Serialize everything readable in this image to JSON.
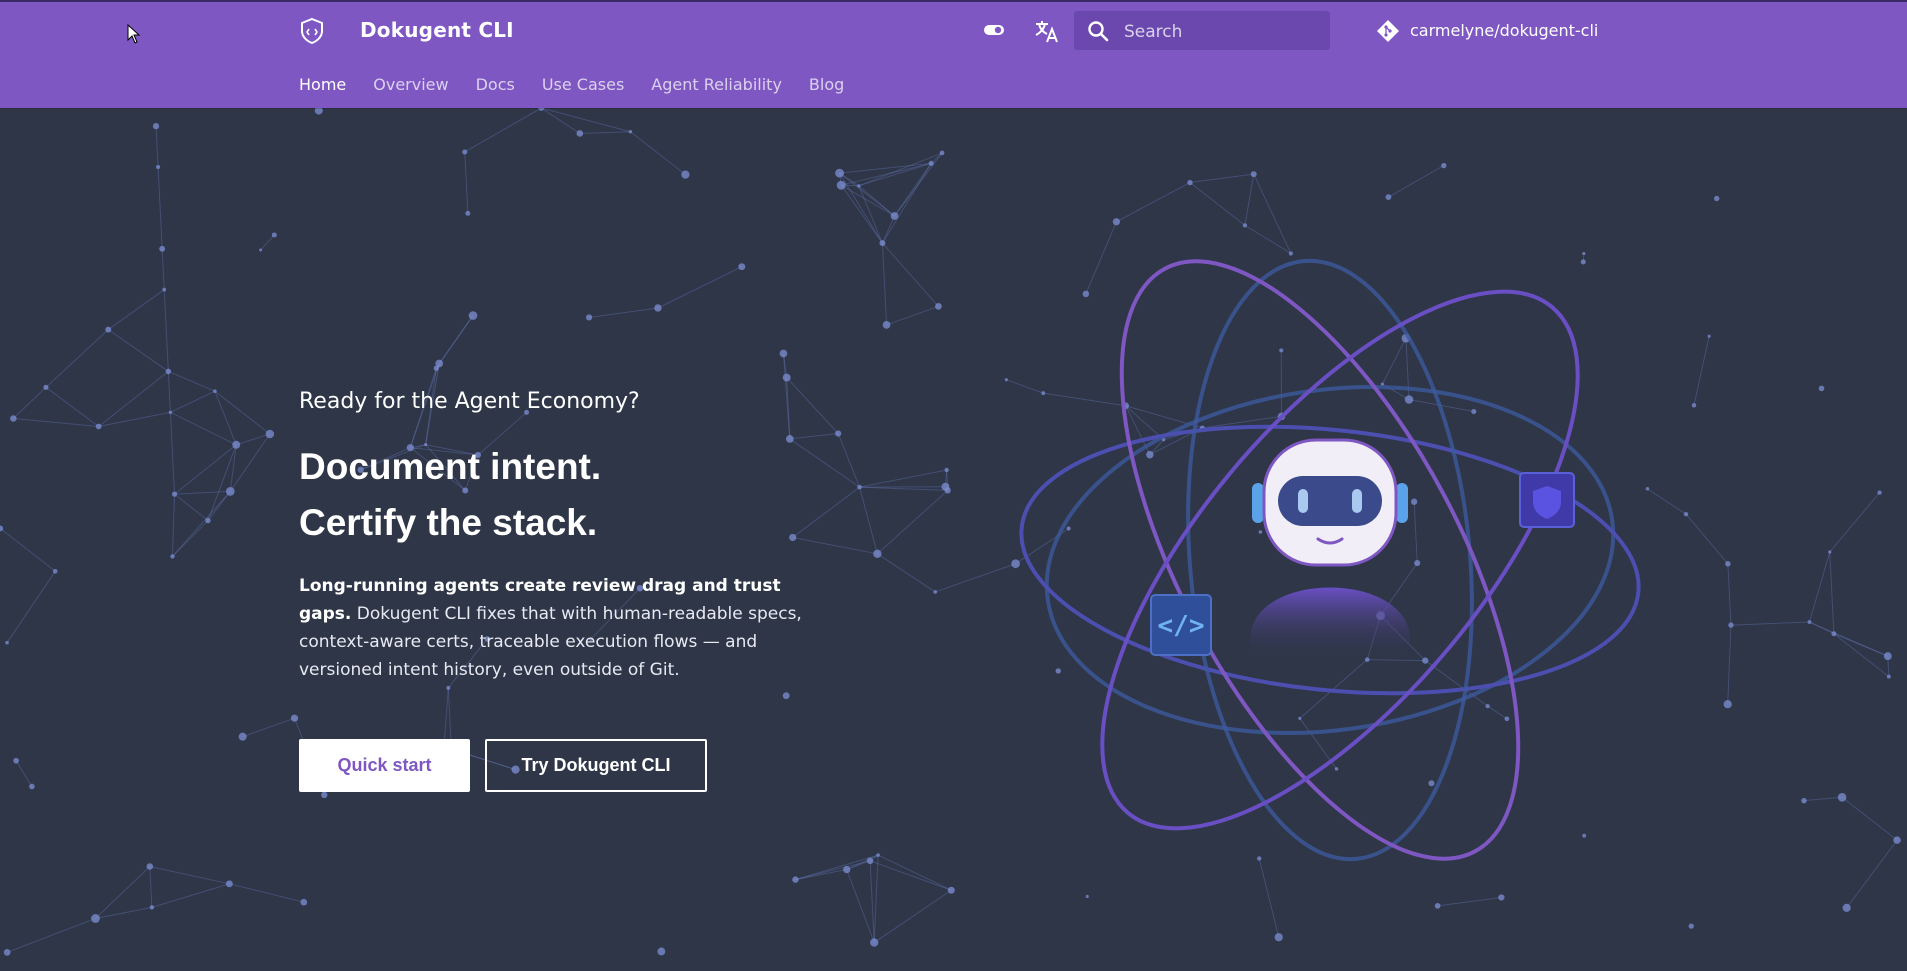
{
  "header": {
    "site_title": "Dokugent CLI",
    "logo_icon": "shield-code-icon",
    "theme_toggle_icon": "toggle-icon",
    "translate_icon": "translate-icon",
    "search": {
      "placeholder": "Search",
      "value": "",
      "icon": "search-icon"
    },
    "repo": {
      "label": "carmelyne/dokugent-cli",
      "icon": "git-icon"
    }
  },
  "nav": {
    "items": [
      {
        "label": "Home",
        "active": true
      },
      {
        "label": "Overview"
      },
      {
        "label": "Docs"
      },
      {
        "label": "Use Cases"
      },
      {
        "label": "Agent Reliability"
      },
      {
        "label": "Blog"
      }
    ]
  },
  "hero": {
    "subtitle": "Ready for the Agent Economy?",
    "headline_line1": "Document intent.",
    "headline_line2": "Certify the stack.",
    "description_bold": "Long-running agents create review drag and trust gaps.",
    "description_rest": "Dokugent CLI fixes that with human-readable specs, context-aware certs, traceable execution flows — and versioned intent history, even outside of Git.",
    "primary_button": "Quick start",
    "secondary_button": "Try Dokugent CLI",
    "illustration_icons": [
      "robot-icon",
      "code-icon",
      "shield-icon"
    ]
  },
  "colors": {
    "header_bg": "#7e57c2",
    "page_bg": "#2e3648",
    "accent": "#7e57c2",
    "orbit_purple": "#7e57c2",
    "orbit_blue": "#3d5a9e"
  }
}
